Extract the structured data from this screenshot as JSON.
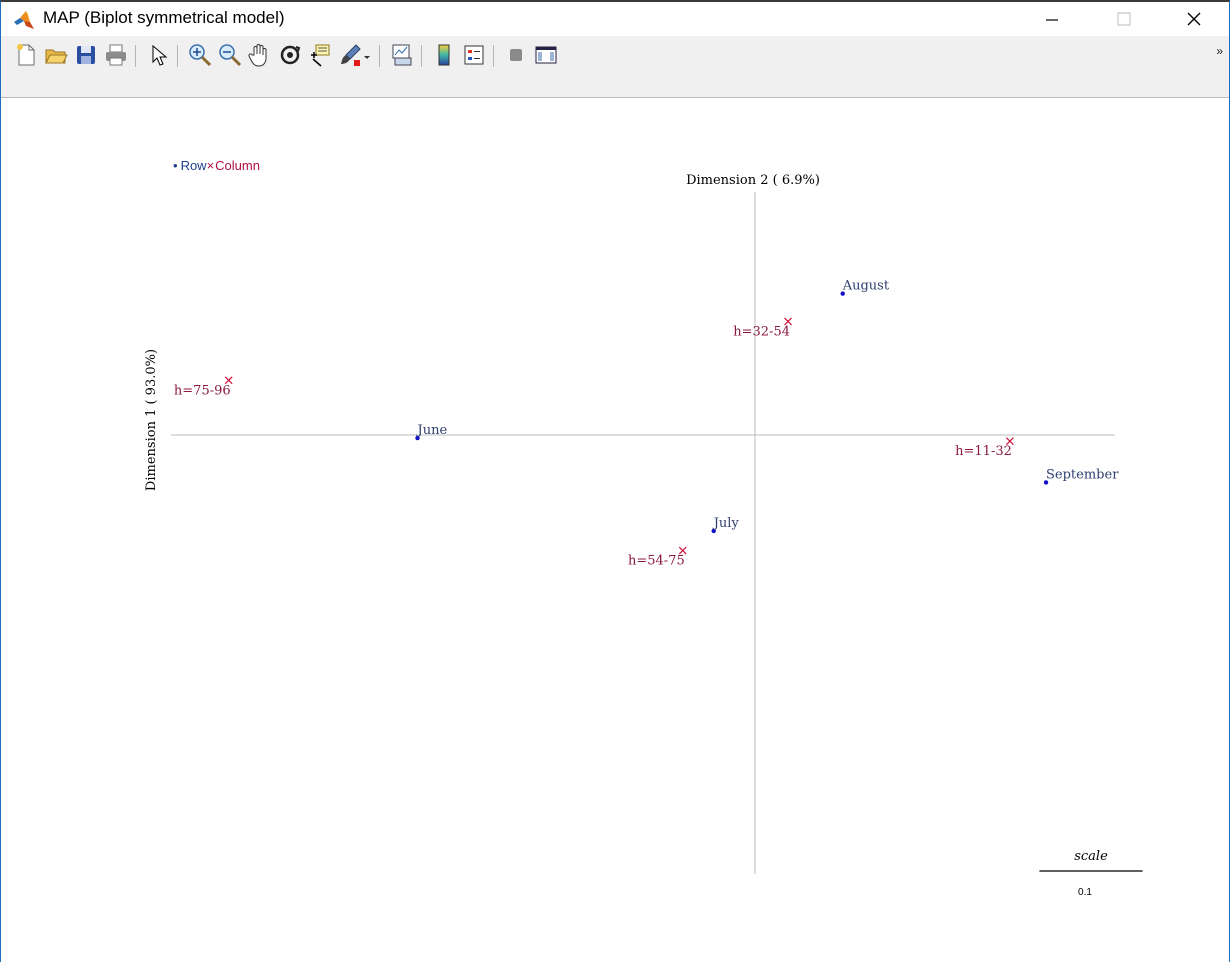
{
  "window": {
    "title": "MAP (Biplot symmetrical model)",
    "minimize_label": "—",
    "maximize_label": "☐",
    "close_label": "✕"
  },
  "toolbar": {
    "buttons": [
      "new-figure",
      "open-file",
      "save",
      "print",
      "edit-plot",
      "zoom-in",
      "zoom-out",
      "pan",
      "rotate-3d",
      "data-cursor",
      "brush",
      "link-plot",
      "colorbar",
      "legend",
      "hide-plot-tools",
      "show-plot-tools"
    ],
    "overflow_label": "»"
  },
  "chart_data": {
    "type": "scatter",
    "title": "",
    "legend": {
      "row_marker": "•",
      "row_label": "Row",
      "column_marker": "×",
      "column_label": "Column",
      "placement": "top-left",
      "row_color": "#1f3f8f",
      "column_color": "#b01040"
    },
    "xlabel": "Dimension  1 ( 93.0%)",
    "ylabel": "Dimension  2 (  6.9%)",
    "xlim": [
      -0.58,
      0.36
    ],
    "ylim": [
      -0.44,
      0.24
    ],
    "axes_lines": true,
    "grid": false,
    "series": [
      {
        "name": "Row",
        "marker": "dot",
        "color": "#1010cc",
        "label_color": "#2f3f6f",
        "points": [
          {
            "label": "June",
            "x": -0.327,
            "y": -0.003
          },
          {
            "label": "August",
            "x": 0.085,
            "y": 0.137
          },
          {
            "label": "September",
            "x": 0.282,
            "y": -0.046
          },
          {
            "label": "July",
            "x": -0.04,
            "y": -0.093
          }
        ]
      },
      {
        "name": "Column",
        "marker": "cross",
        "color": "#d0103a",
        "label_color": "#8b1a3a",
        "points": [
          {
            "label": "h=75-96",
            "x": -0.51,
            "y": 0.053
          },
          {
            "label": "h=32-54",
            "x": 0.032,
            "y": 0.11
          },
          {
            "label": "h=11-32",
            "x": 0.247,
            "y": -0.006
          },
          {
            "label": "h=54-75",
            "x": -0.07,
            "y": -0.112
          }
        ]
      }
    ],
    "scale_bar": {
      "title": "scale",
      "value": 0.1,
      "label": "0.1"
    }
  }
}
